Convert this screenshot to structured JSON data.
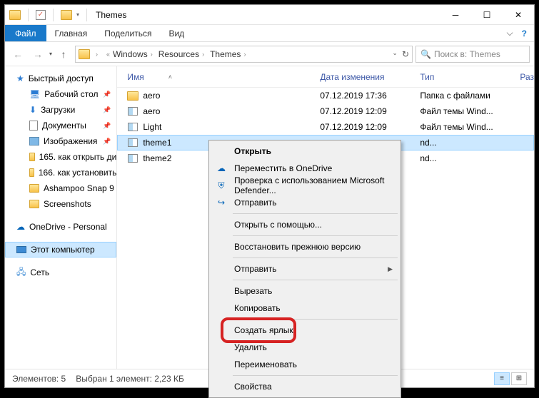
{
  "title": "Themes",
  "tabs": {
    "file": "Файл",
    "home": "Главная",
    "share": "Поделиться",
    "view": "Вид"
  },
  "breadcrumb": [
    "Windows",
    "Resources",
    "Themes"
  ],
  "search_placeholder": "Поиск в: Themes",
  "sidebar": {
    "quick": "Быстрый доступ",
    "items": [
      "Рабочий стол",
      "Загрузки",
      "Документы",
      "Изображения",
      "165. как открыть ди",
      "166. как установить",
      "Ashampoo Snap 9",
      "Screenshots"
    ],
    "onedrive": "OneDrive - Personal",
    "thispc": "Этот компьютер",
    "network": "Сеть"
  },
  "columns": {
    "name": "Имя",
    "date": "Дата изменения",
    "type": "Тип",
    "size": "Раз"
  },
  "rows": [
    {
      "name": "aero",
      "date": "07.12.2019 17:36",
      "type": "Папка с файлами",
      "kind": "folder"
    },
    {
      "name": "aero",
      "date": "07.12.2019 12:09",
      "type": "Файл темы Wind...",
      "kind": "theme"
    },
    {
      "name": "Light",
      "date": "07.12.2019 12:09",
      "type": "Файл темы Wind...",
      "kind": "theme"
    },
    {
      "name": "theme1",
      "date": "",
      "type": "nd...",
      "kind": "theme",
      "selected": true
    },
    {
      "name": "theme2",
      "date": "",
      "type": "nd...",
      "kind": "theme"
    }
  ],
  "context_menu": [
    {
      "label": "Открыть",
      "bold": true
    },
    {
      "label": "Переместить в OneDrive",
      "icon": "cloud"
    },
    {
      "label": "Проверка с использованием Microsoft Defender...",
      "icon": "shield"
    },
    {
      "label": "Отправить",
      "icon": "share"
    },
    {
      "sep": true
    },
    {
      "label": "Открыть с помощью..."
    },
    {
      "sep": true
    },
    {
      "label": "Восстановить прежнюю версию"
    },
    {
      "sep": true
    },
    {
      "label": "Отправить",
      "submenu": true
    },
    {
      "sep": true
    },
    {
      "label": "Вырезать"
    },
    {
      "label": "Копировать"
    },
    {
      "sep": true
    },
    {
      "label": "Создать ярлык"
    },
    {
      "label": "Удалить"
    },
    {
      "label": "Переименовать"
    },
    {
      "sep": true
    },
    {
      "label": "Свойства"
    }
  ],
  "status": {
    "count": "Элементов: 5",
    "selection": "Выбран 1 элемент: 2,23 КБ"
  }
}
